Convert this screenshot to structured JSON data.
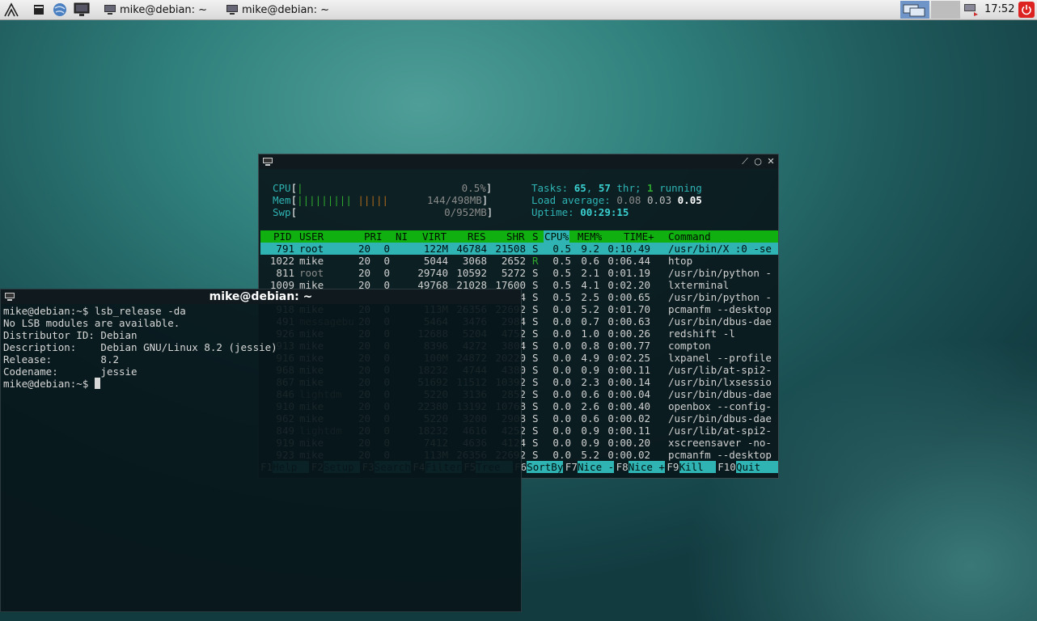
{
  "taskbar": {
    "tasks": [
      {
        "label": "mike@debian: ~"
      },
      {
        "label": "mike@debian: ~"
      }
    ],
    "clock": "17:52"
  },
  "terminal": {
    "title": "mike@debian: ~",
    "lines": [
      "mike@debian:~$ lsb_release -da",
      "No LSB modules are available.",
      "Distributor ID:\tDebian",
      "Description:\tDebian GNU/Linux 8.2 (jessie)",
      "Release:\t8.2",
      "Codename:\tjessie"
    ],
    "prompt": "mike@debian:~$ "
  },
  "htop": {
    "meters": {
      "cpu_label": "CPU",
      "cpu_value": "0.5%",
      "mem_label": "Mem",
      "mem_value": "144/498MB",
      "swp_label": "Swp",
      "swp_value": "0/952MB"
    },
    "tasks_line": {
      "prefix": "Tasks: ",
      "tasks": "65",
      "sep": ", ",
      "threads": "57",
      "thr": " thr; ",
      "running": "1",
      "running_label": " running"
    },
    "load_line": {
      "prefix": "Load average: ",
      "l1": "0.08",
      "l5": "0.03",
      "l15": "0.05"
    },
    "uptime_line": {
      "prefix": "Uptime: ",
      "value": "00:29:15"
    },
    "columns": [
      "PID",
      "USER",
      "PRI",
      "NI",
      "VIRT",
      "RES",
      "SHR",
      "S",
      "CPU%",
      "MEM%",
      "TIME+",
      "Command"
    ],
    "processes": [
      [
        "791",
        "root",
        "20",
        "0",
        "122M",
        "46784",
        "21508",
        "S",
        "0.5",
        "9.2",
        "0:10.49",
        "/usr/bin/X :0 -se"
      ],
      [
        "1022",
        "mike",
        "20",
        "0",
        "5044",
        "3068",
        "2652",
        "R",
        "0.5",
        "0.6",
        "0:06.44",
        "htop"
      ],
      [
        "811",
        "root",
        "20",
        "0",
        "29740",
        "10592",
        "5272",
        "S",
        "0.5",
        "2.1",
        "0:01.19",
        "/usr/bin/python -"
      ],
      [
        "1009",
        "mike",
        "20",
        "0",
        "49768",
        "21028",
        "17600",
        "S",
        "0.5",
        "4.1",
        "0:02.20",
        "lxterminal"
      ],
      [
        "",
        "",
        "",
        "",
        "",
        "",
        "4",
        "S",
        "0.5",
        "2.5",
        "0:00.65",
        "/usr/bin/python -"
      ],
      [
        "918",
        "mike",
        "20",
        "0",
        "113M",
        "26356",
        "22692",
        "S",
        "0.0",
        "5.2",
        "0:01.70",
        "pcmanfm --desktop"
      ],
      [
        "491",
        "messagebu",
        "20",
        "0",
        "5464",
        "3476",
        "2984",
        "S",
        "0.0",
        "0.7",
        "0:00.63",
        "/usr/bin/dbus-dae"
      ],
      [
        "926",
        "mike",
        "20",
        "0",
        "12688",
        "5204",
        "4752",
        "S",
        "0.0",
        "1.0",
        "0:00.26",
        "redshift -l"
      ],
      [
        "913",
        "mike",
        "20",
        "0",
        "8396",
        "4272",
        "3804",
        "S",
        "0.0",
        "0.8",
        "0:00.77",
        "compton"
      ],
      [
        "916",
        "mike",
        "20",
        "0",
        "100M",
        "24872",
        "20220",
        "S",
        "0.0",
        "4.9",
        "0:02.25",
        "lxpanel --profile"
      ],
      [
        "968",
        "mike",
        "20",
        "0",
        "18232",
        "4744",
        "4380",
        "S",
        "0.0",
        "0.9",
        "0:00.11",
        "/usr/lib/at-spi2-"
      ],
      [
        "867",
        "mike",
        "20",
        "0",
        "51692",
        "11512",
        "10392",
        "S",
        "0.0",
        "2.3",
        "0:00.14",
        "/usr/bin/lxsessio"
      ],
      [
        "846",
        "lightdm",
        "20",
        "0",
        "5220",
        "3136",
        "2852",
        "S",
        "0.0",
        "0.6",
        "0:00.04",
        "/usr/bin/dbus-dae"
      ],
      [
        "910",
        "mike",
        "20",
        "0",
        "22380",
        "13192",
        "10768",
        "S",
        "0.0",
        "2.6",
        "0:00.40",
        "openbox --config-"
      ],
      [
        "962",
        "mike",
        "20",
        "0",
        "5220",
        "3200",
        "2908",
        "S",
        "0.0",
        "0.6",
        "0:00.02",
        "/usr/bin/dbus-dae"
      ],
      [
        "849",
        "lightdm",
        "20",
        "0",
        "18232",
        "4616",
        "4252",
        "S",
        "0.0",
        "0.9",
        "0:00.11",
        "/usr/lib/at-spi2-"
      ],
      [
        "919",
        "mike",
        "20",
        "0",
        "7412",
        "4636",
        "4124",
        "S",
        "0.0",
        "0.9",
        "0:00.20",
        "xscreensaver -no-"
      ],
      [
        "923",
        "mike",
        "20",
        "0",
        "113M",
        "26356",
        "22692",
        "S",
        "0.0",
        "5.2",
        "0:00.02",
        "pcmanfm --desktop"
      ]
    ],
    "fkeys": [
      {
        "key": "F1",
        "label": "Help  "
      },
      {
        "key": "F2",
        "label": "Setup "
      },
      {
        "key": "F3",
        "label": "Search"
      },
      {
        "key": "F4",
        "label": "Filter"
      },
      {
        "key": "F5",
        "label": "Tree  "
      },
      {
        "key": "F6",
        "label": "SortBy"
      },
      {
        "key": "F7",
        "label": "Nice -"
      },
      {
        "key": "F8",
        "label": "Nice +"
      },
      {
        "key": "F9",
        "label": "Kill  "
      },
      {
        "key": "F10",
        "label": "Quit"
      }
    ]
  }
}
